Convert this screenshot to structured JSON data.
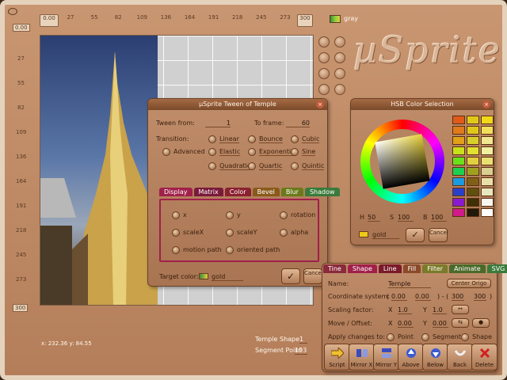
{
  "ruler": {
    "top_start": "0.00",
    "top_ticks": [
      "27",
      "55",
      "82",
      "109",
      "136",
      "164",
      "191",
      "218",
      "245",
      "273"
    ],
    "top_end": "300",
    "left_start": "0.00",
    "left_ticks": [
      "27",
      "55",
      "82",
      "109",
      "136",
      "164",
      "191",
      "218",
      "245",
      "273"
    ],
    "left_end": "300"
  },
  "color_chip": {
    "label": "gray"
  },
  "logo": "µSprite",
  "status": {
    "coords": "x: 232.36 y: 84.55"
  },
  "tween": {
    "title": "µSprite Tween of Temple",
    "from_label": "Tween from:",
    "from_value": "1",
    "to_label": "To frame:",
    "to_value": "60",
    "transition_label": "Transition:",
    "advanced": "Advanced",
    "options": [
      "Linear",
      "Bounce",
      "Cubic",
      "Elastic",
      "Exponential",
      "Sine",
      "Quadratic",
      "Quartic",
      "Quintic"
    ],
    "tabs": [
      "Display",
      "Matrix",
      "Color",
      "Bevel",
      "Blur",
      "Shadow"
    ],
    "props": [
      "x",
      "y",
      "rotation",
      "scaleX",
      "scaleY",
      "alpha",
      "motion path",
      "oriented path"
    ],
    "target_label": "Target color:",
    "target_value": "gold",
    "ok": "OK",
    "cancel": "Cancel"
  },
  "hsb": {
    "title": "HSB Color Selection",
    "h_label": "H",
    "h": "50",
    "s_label": "S",
    "s": "100",
    "b_label": "B",
    "b": "100",
    "selected": "gold",
    "cancel": "Cancel",
    "palette": [
      "#e05a1a",
      "#e0c81a",
      "#f0d81a",
      "#e07a1a",
      "#e0c81a",
      "#f0e05a",
      "#e0a01a",
      "#d8d02a",
      "#f0e890",
      "#c8e01a",
      "#e0e030",
      "#f0f0a0",
      "#6ae01a",
      "#e0d040",
      "#e8e070",
      "#1ad050",
      "#a0a020",
      "#d8d090",
      "#1a9ae0",
      "#806018",
      "#e8e0a8",
      "#2a40c8",
      "#605010",
      "#e8e8c0",
      "#8a1ad0",
      "#403008",
      "#f8f8f0",
      "#d01a8a",
      "#201808",
      "#ffffff"
    ]
  },
  "shape": {
    "tabs": [
      "Tine",
      "Shape",
      "Line",
      "Fill",
      "Filter",
      "Animate",
      "SVG"
    ],
    "name_label": "Name:",
    "name": "Temple",
    "center_btn": "Center Origo",
    "coord_label": "Coordinate system:",
    "coord_vals": [
      "0.00",
      "0.00",
      "300",
      "300"
    ],
    "scale_label": "Scaling factor:",
    "scale_x": "1.0",
    "scale_y": "1.0",
    "move_label": "Move / Offset:",
    "move_x": "0.00",
    "move_y": "0.00",
    "apply_label": "Apply changes to:",
    "apply_opts": [
      "Point",
      "Segment",
      "Shape"
    ],
    "buttons": [
      "Script",
      "Mirror X",
      "Mirror Y",
      "Above",
      "Below",
      "Back",
      "Delete"
    ]
  },
  "footer": {
    "temple_shape_label": "Temple Shape",
    "temple_shape": "1",
    "segment_label": "Segment Point",
    "segment": "193"
  }
}
